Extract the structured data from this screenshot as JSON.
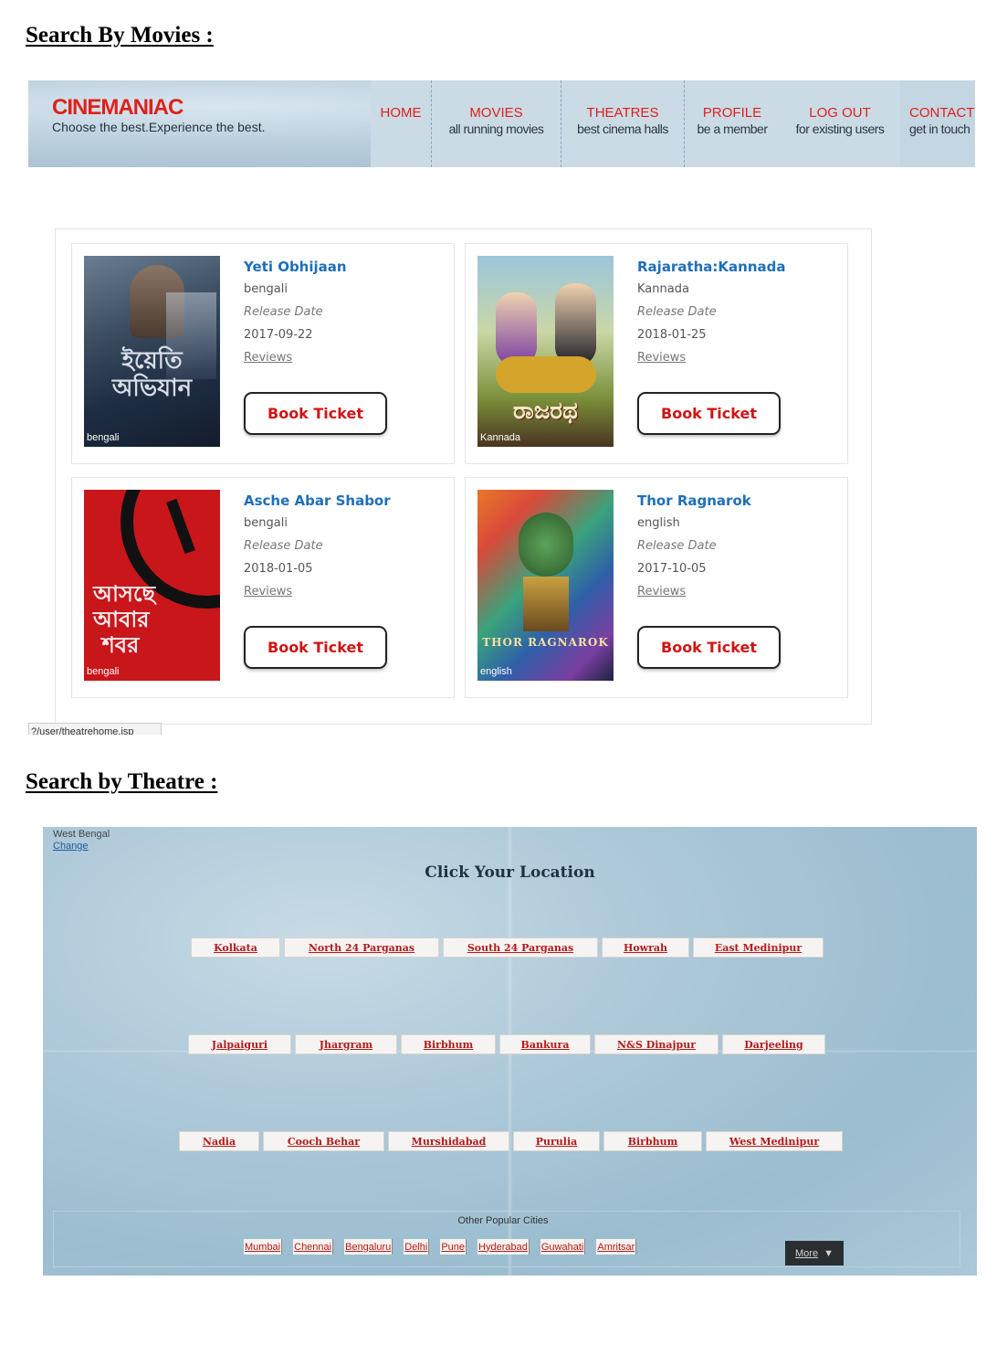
{
  "sections": {
    "movies_heading": "Search By Movies :",
    "theatre_heading": "Search by Theatre :"
  },
  "header": {
    "logo": "CINEMANIAC",
    "tagline": "Choose the best.Experience the best.",
    "nav": [
      {
        "title": "HOME",
        "sub": ""
      },
      {
        "title": "MOVIES",
        "sub": "all running movies"
      },
      {
        "title": "THEATRES",
        "sub": "best cinema halls"
      },
      {
        "title": "PROFILE",
        "sub": "be a member"
      },
      {
        "title": "LOG OUT",
        "sub": "for existing users"
      },
      {
        "title": "CONTACT",
        "sub": "get in touch"
      }
    ]
  },
  "movies": [
    {
      "title": "Yeti Obhijaan",
      "language": "bengali",
      "release_label": "Release Date",
      "release_date": "2017-09-22",
      "reviews": "Reviews",
      "book": "Book Ticket",
      "poster_lang": "bengali",
      "poster_text": "ইয়েতি অভিযান"
    },
    {
      "title": "Rajaratha:Kannada",
      "language": "Kannada",
      "release_label": "Release Date",
      "release_date": "2018-01-25",
      "reviews": "Reviews",
      "book": "Book Ticket",
      "poster_lang": "Kannada",
      "poster_text": "ರಾಜರಥ"
    },
    {
      "title": "Asche Abar Shabor",
      "language": "bengali",
      "release_label": "Release Date",
      "release_date": "2018-01-05",
      "reviews": "Reviews",
      "book": "Book Ticket",
      "poster_lang": "bengali",
      "poster_text": "আসছে আবার শবর"
    },
    {
      "title": "Thor Ragnarok",
      "language": "english",
      "release_label": "Release Date",
      "release_date": "2017-10-05",
      "reviews": "Reviews",
      "book": "Book Ticket",
      "poster_lang": "english",
      "poster_text": "THOR RAGNAROK"
    }
  ],
  "status_url": "?/user/theatrehome.jsp",
  "theatre": {
    "state": "West Bengal",
    "change": "Change",
    "title": "Click Your Location",
    "rows": [
      [
        "Kolkata",
        "North 24 Parganas",
        "South 24 Parganas",
        "Howrah",
        "East Medinipur"
      ],
      [
        "Jalpaiguri",
        "Jhargram",
        "Birbhum",
        "Bankura",
        "N&S Dinajpur",
        "Darjeeling"
      ],
      [
        "Nadia",
        "Cooch Behar",
        "Murshidabad",
        "Purulia",
        "Birbhum",
        "West Medinipur"
      ]
    ],
    "other_title": "Other Popular Cities",
    "cities": [
      "Mumbai",
      "Chennai",
      "Bengaluru",
      "Delhi",
      "Pune",
      "Hyderabad",
      "Guwahati",
      "Amritsar"
    ],
    "more": "More"
  },
  "colors": {
    "accent_red": "#e0201a",
    "title_blue": "#1f6fb8",
    "button_red": "#d01414"
  }
}
